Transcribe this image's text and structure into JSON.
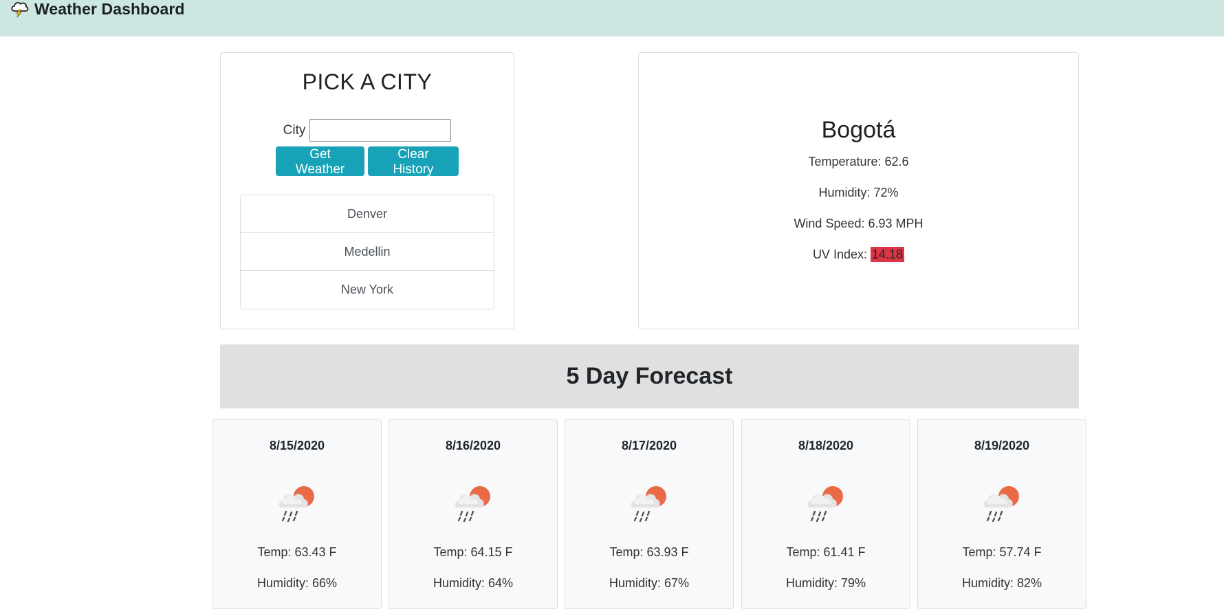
{
  "header": {
    "logo_icon": "cloud-lightning-icon",
    "title": "Weather Dashboard"
  },
  "search": {
    "title": "PICK A CITY",
    "city_label": "City",
    "city_value": "",
    "get_weather_label": "Get Weather",
    "clear_history_label": "Clear History",
    "history": [
      {
        "label": "Denver"
      },
      {
        "label": "Medellin"
      },
      {
        "label": "New York"
      }
    ]
  },
  "current": {
    "city": "Bogotá",
    "temperature": "Temperature: 62.6",
    "humidity": "Humidity: 72%",
    "wind": "Wind Speed: 6.93 MPH",
    "uv_label": "UV Index:",
    "uv_value": "14.18",
    "uv_color": "#dc3545"
  },
  "forecast": {
    "title": "5 Day Forecast",
    "days": [
      {
        "date": "8/15/2020",
        "icon": "rain-sun-icon",
        "temp": "Temp: 63.43 F",
        "humidity": "Humidity: 66%"
      },
      {
        "date": "8/16/2020",
        "icon": "rain-sun-icon",
        "temp": "Temp: 64.15 F",
        "humidity": "Humidity: 64%"
      },
      {
        "date": "8/17/2020",
        "icon": "rain-sun-icon",
        "temp": "Temp: 63.93 F",
        "humidity": "Humidity: 67%"
      },
      {
        "date": "8/18/2020",
        "icon": "rain-sun-icon",
        "temp": "Temp: 61.41 F",
        "humidity": "Humidity: 79%"
      },
      {
        "date": "8/19/2020",
        "icon": "rain-sun-icon",
        "temp": "Temp: 57.74 F",
        "humidity": "Humidity: 82%"
      }
    ]
  },
  "colors": {
    "navbar": "#cce7e1",
    "button": "#17a2b8",
    "forecast_header": "#e0e0e0",
    "uv_badge": "#dc3545"
  }
}
